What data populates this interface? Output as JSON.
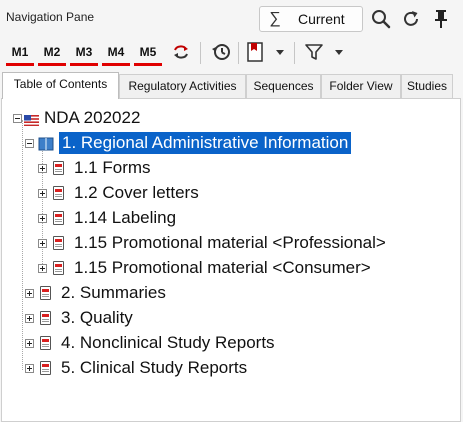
{
  "pane": {
    "title": "Navigation Pane"
  },
  "search": {
    "sigma": "∑",
    "label": "Current"
  },
  "toolbar": {
    "m_buttons": [
      "M1",
      "M2",
      "M3",
      "M4",
      "M5"
    ]
  },
  "tabs": [
    {
      "label": "Table of Contents",
      "active": true
    },
    {
      "label": "Regulatory Activities",
      "active": false
    },
    {
      "label": "Sequences",
      "active": false
    },
    {
      "label": "Folder View",
      "active": false
    },
    {
      "label": "Studies",
      "active": false
    }
  ],
  "tree": {
    "root": "NDA 202022",
    "selected": "1. Regional Administrative Information",
    "children_of_selected": [
      "1.1 Forms",
      "1.2 Cover letters",
      "1.14 Labeling",
      "1.15 Promotional material <Professional>",
      "1.15 Promotional material <Consumer>"
    ],
    "modules": [
      "2. Summaries",
      "3. Quality",
      "4. Nonclinical Study Reports",
      "5. Clinical Study Reports"
    ]
  },
  "colors": {
    "accent": "#e00000",
    "selection": "#0a63c9"
  }
}
